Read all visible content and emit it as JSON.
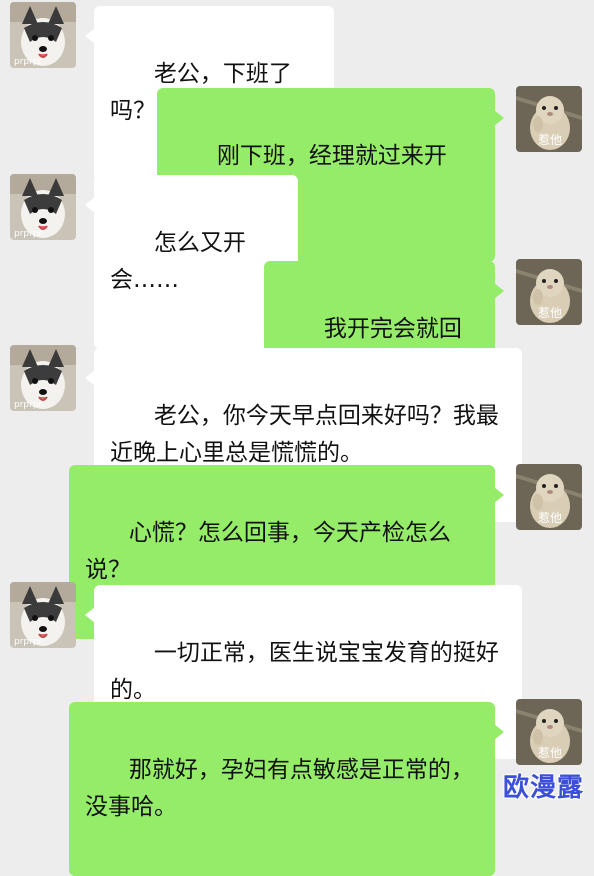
{
  "contacts": {
    "wife": {
      "avatar_icon": "husky-dog-avatar",
      "avatar_caption": "prprpr"
    },
    "husband": {
      "avatar_icon": "hamster-avatar",
      "avatar_caption": "惹他"
    }
  },
  "messages": [
    {
      "side": "in",
      "sender": "wife",
      "text": "老公，下班了吗？"
    },
    {
      "side": "out",
      "sender": "husband",
      "text": "刚下班，经理就过来开会。"
    },
    {
      "side": "in",
      "sender": "wife",
      "text": "怎么又开会……"
    },
    {
      "side": "out",
      "sender": "husband",
      "text": "我开完会就回去。"
    },
    {
      "side": "in",
      "sender": "wife",
      "text": "老公，你今天早点回来好吗？我最\n近晚上心里总是慌慌的。"
    },
    {
      "side": "out",
      "sender": "husband",
      "text": "心慌？怎么回事，今天产检怎么\n说？"
    },
    {
      "side": "in",
      "sender": "wife",
      "text": "一切正常，医生说宝宝发育的挺好\n的。"
    },
    {
      "side": "out",
      "sender": "husband",
      "text": "那就好，孕妇有点敏感是正常的，\n没事哈。"
    }
  ],
  "watermark": "欧漫露"
}
